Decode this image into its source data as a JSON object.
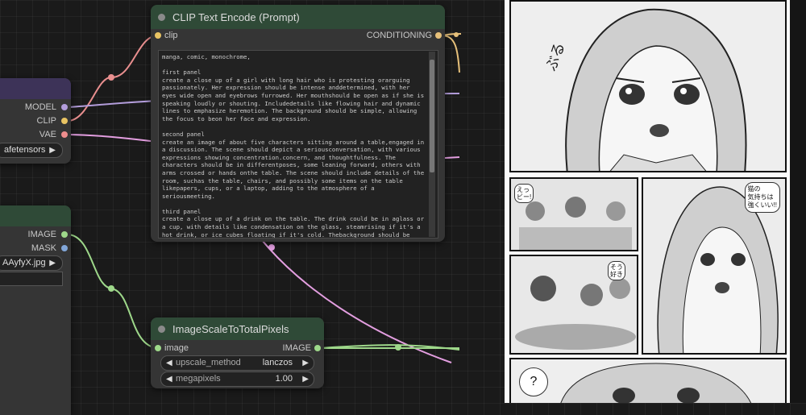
{
  "clip_node": {
    "title": "CLIP Text Encode (Prompt)",
    "input_label": "clip",
    "output_label": "CONDITIONING",
    "prompt_text": "manga, comic, monochrome,\n\nfirst panel\ncreate a close up of a girl with long hair who is protesting orarguing passionately. Her expression should be intense anddetermined, with her eyes wide open and eyebrows furrowed. Her mouthshould be open as if she is speaking loudly or shouting. Includedetails like flowing hair and dynamic lines to emphasize heremotion. The background should be simple, allowing the focus to beon her face and expression.\n\nsecond panel\ncreate an image of about five characters sitting around a table,engaged in a discussion. The scene should depict a seriousconversation, with various expressions showing concentration.concern, and thoughtfulness. The characters should be in differentposes, some leaning forward, others with arms crossed or hands onthe table. The scene should include details of the room, suchas the table, chairs, and possibly some items on the table likepapers, cups, or a laptop, adding to the atmosphere of a seriousmeeting.\n\nthird panel\ncreate a close up of a drink on the table. The drink could be in aglass or a cup, with details like condensation on the glass, steamrising if it's a hot drink, or ice cubes floating if it's cold. Thebackground should be blurred to keep the focus on the drink itself.Add subtle details like light reflections on the surface of thedrink and the texture of the glass or cup to enhance the realism."
  },
  "checkpoint_node": {
    "outputs": [
      "MODEL",
      "CLIP",
      "VAE"
    ],
    "ckpt_value": "afetensors"
  },
  "load_image_node": {
    "outputs": [
      "IMAGE",
      "MASK"
    ],
    "image_value": "AAyfyX.jpg"
  },
  "scale_node": {
    "title": "ImageScaleToTotalPixels",
    "input_label": "image",
    "output_label": "IMAGE",
    "method_label": "upscale_method",
    "method_value": "lanczos",
    "megapixels_label": "megapixels",
    "megapixels_value": "1.00"
  },
  "manga": {
    "sfx_top": "ぶる",
    "bubble_right": "猫の\n気持ちは\n強くいい!!",
    "bubble_left": "えっ\nビー!",
    "bubble_mid": "そう\n好き",
    "bubble_bottom": "?"
  },
  "colors": {
    "clip_wire": "#e98f8f",
    "model_wire": "#b39ddb",
    "vae_wire": "#e39ee0",
    "image_wire": "#9ed88a",
    "cond_wire": "#e6c07a",
    "node_title_green": "#2f4a37",
    "node_title_purple": "#3d3358"
  }
}
